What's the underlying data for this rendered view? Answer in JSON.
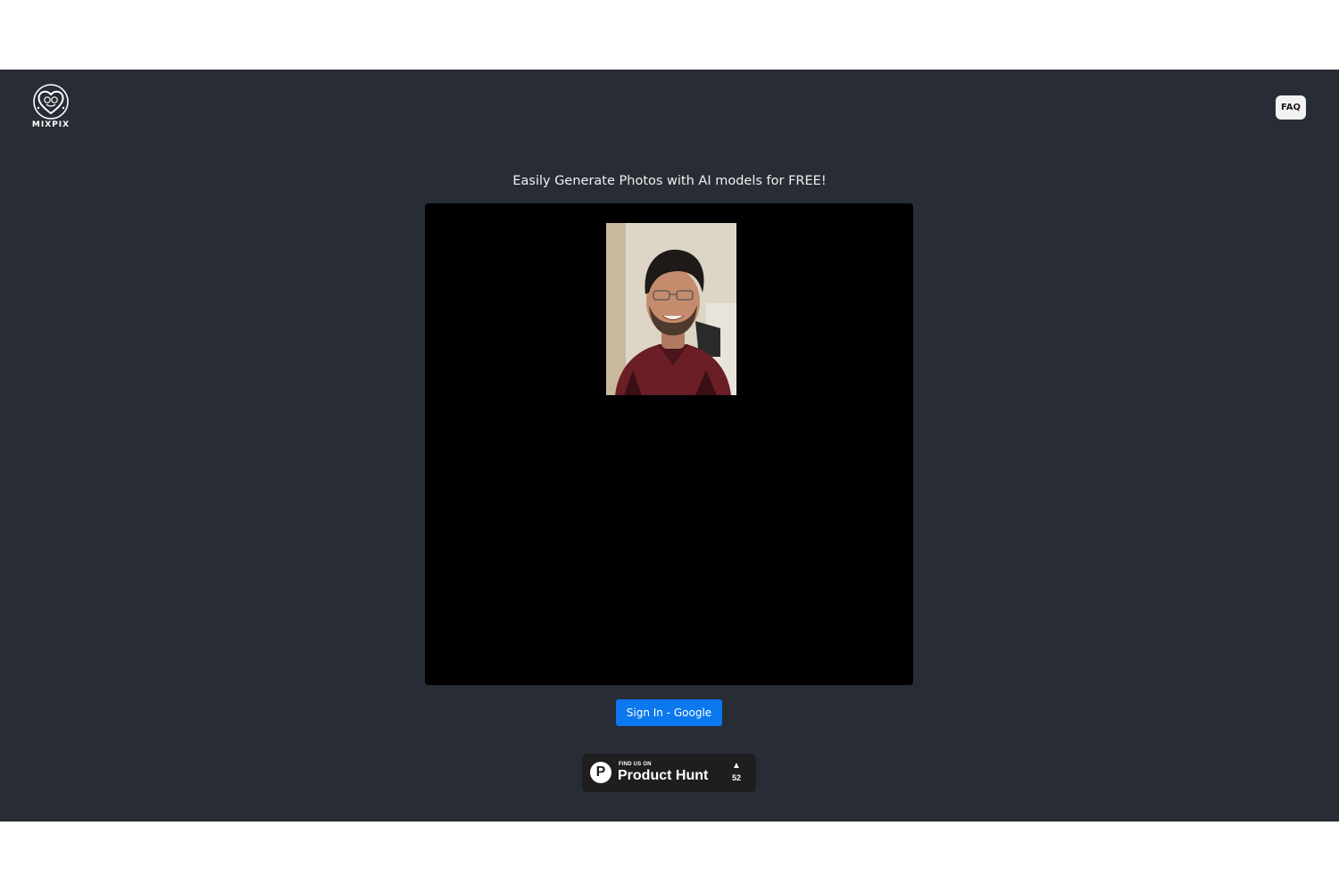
{
  "header": {
    "logo_text": "MIXPIX",
    "logo_icon": "heart-face-logo-icon",
    "faq_label": "FAQ"
  },
  "main": {
    "headline": "Easily Generate Photos with AI models for FREE!",
    "photo_icon": "portrait-photo",
    "signin_label": "Sign In - Google",
    "signin_color": "#0b78ef"
  },
  "badge": {
    "small_text": "FIND US ON",
    "big_text": "Product Hunt",
    "logo_letter": "P",
    "upvote_icon": "▲",
    "count": "52"
  },
  "colors": {
    "app_bg": "#282c35",
    "stage_bg": "#000000",
    "badge_bg": "#1e1e1e"
  }
}
